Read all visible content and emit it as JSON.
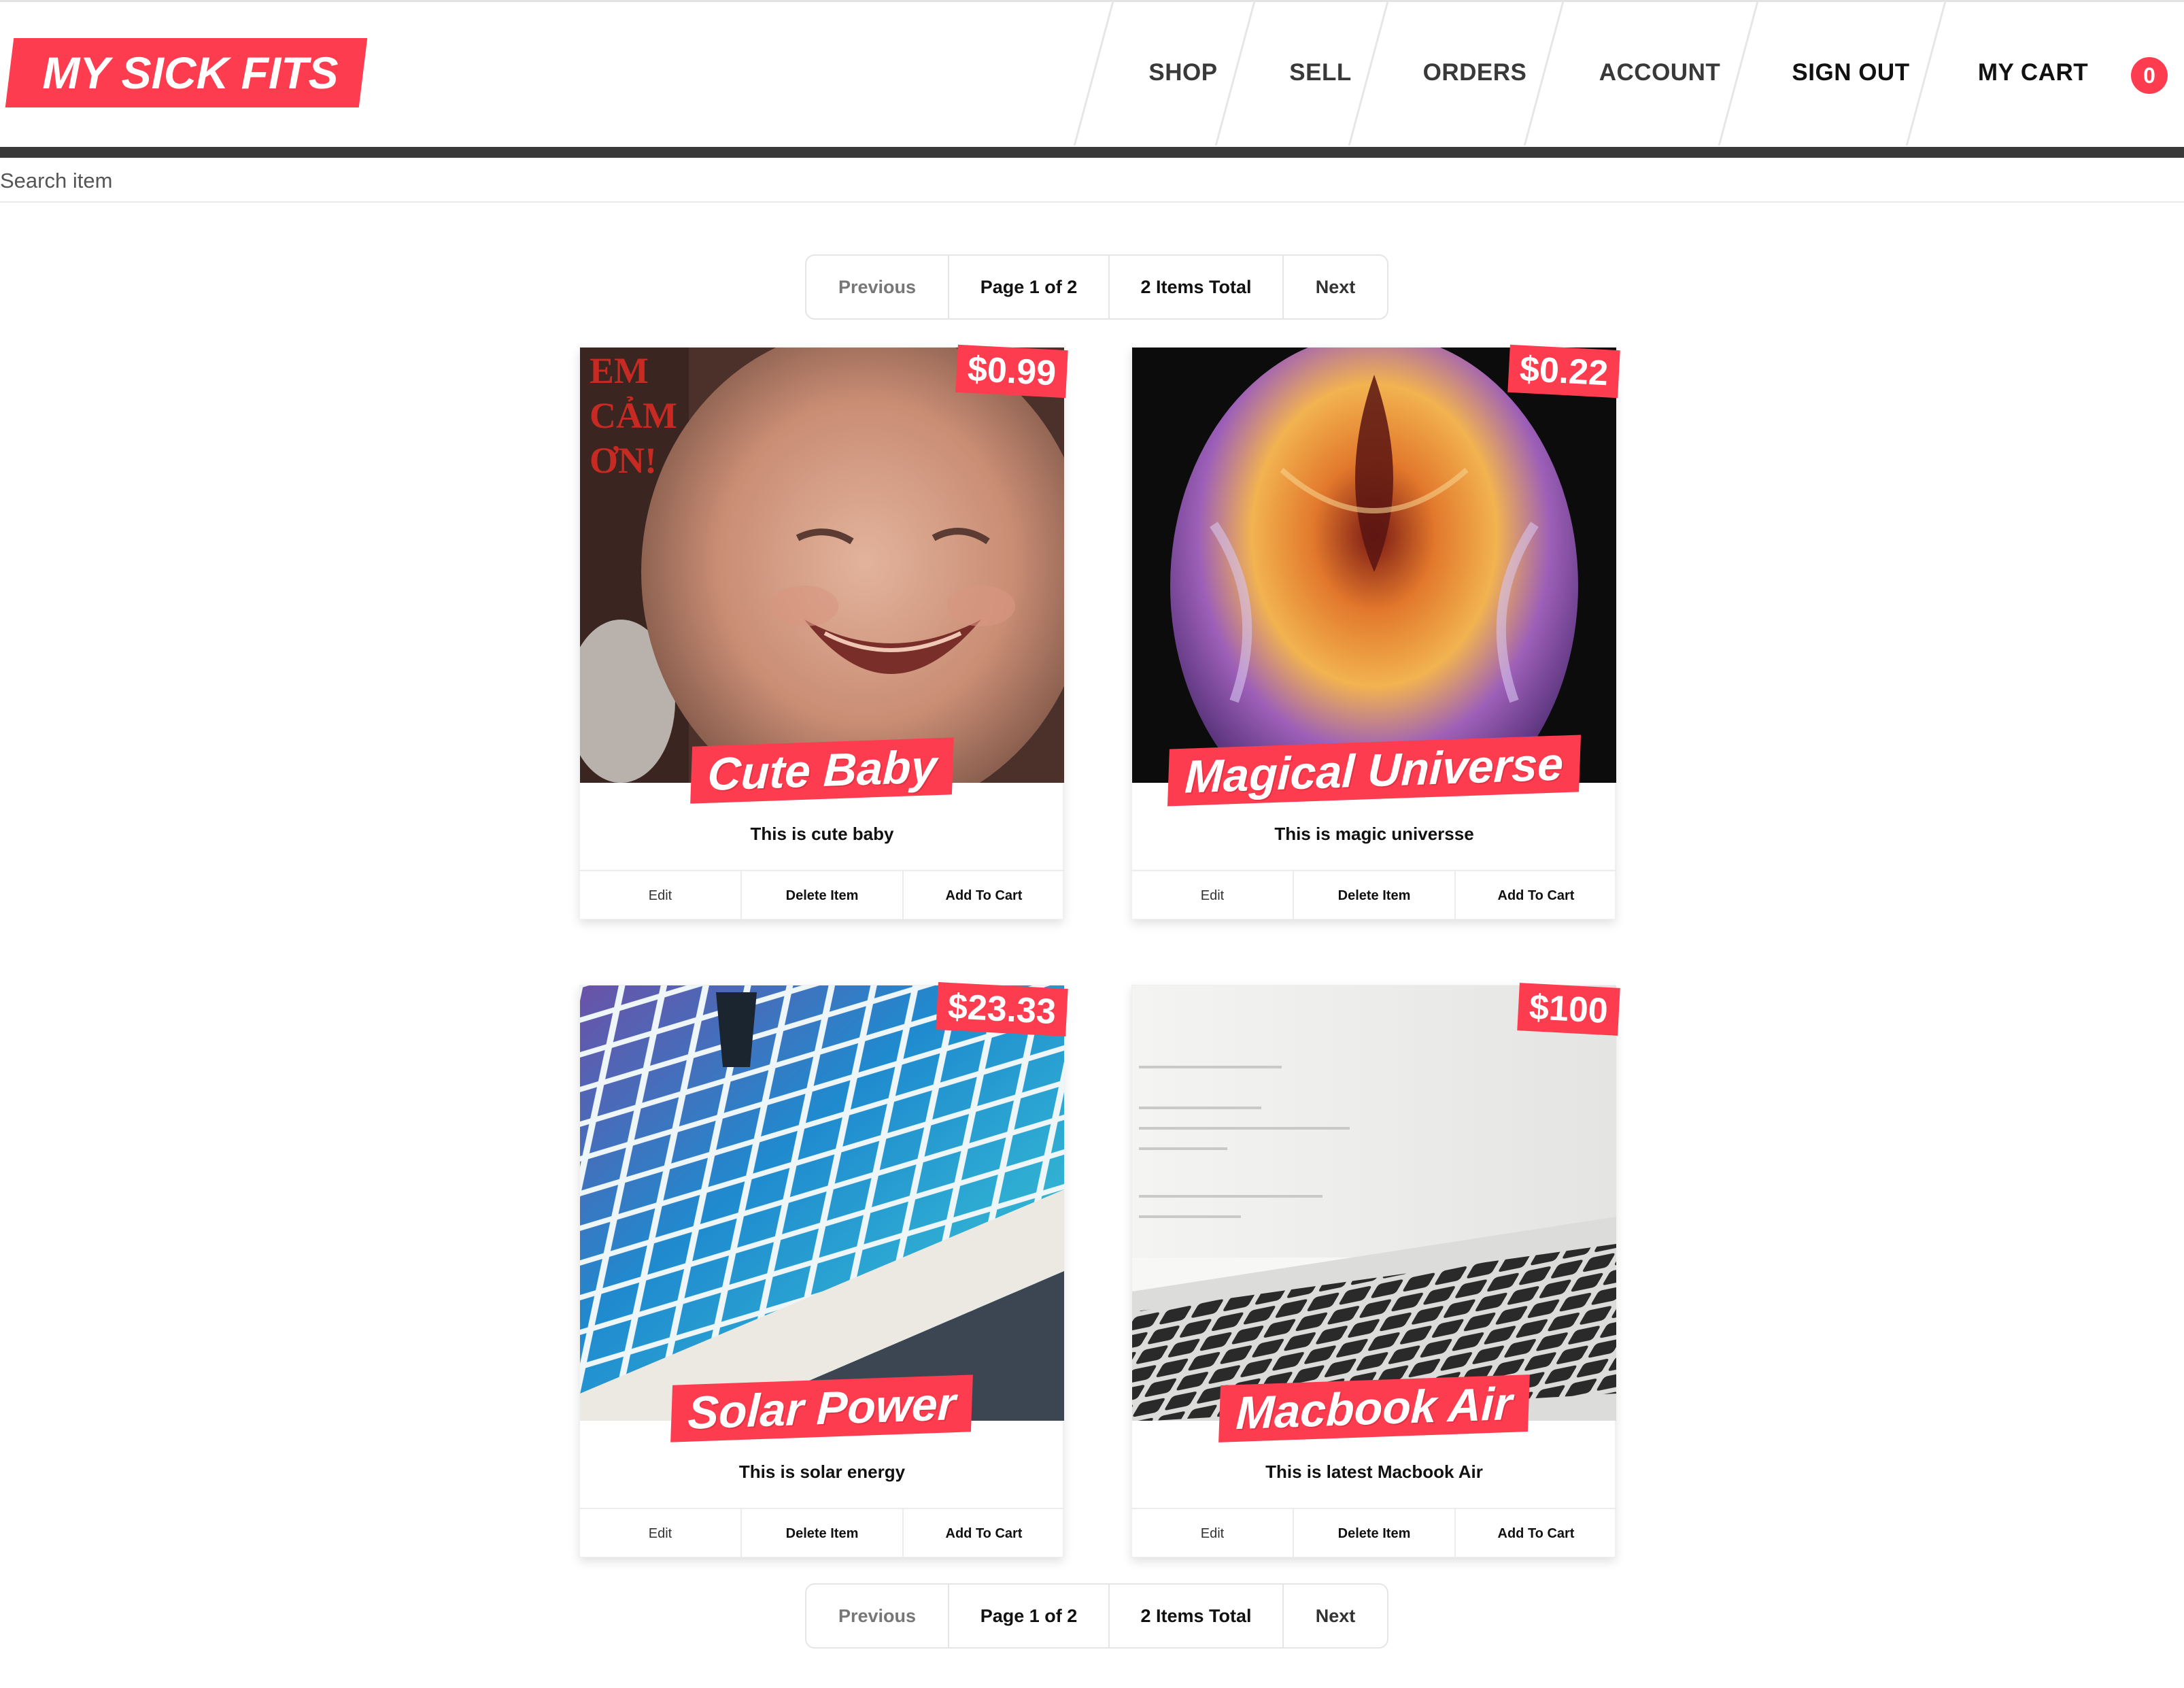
{
  "header": {
    "logo": "MY SICK FITS",
    "nav": [
      {
        "label": "SHOP"
      },
      {
        "label": "SELL"
      },
      {
        "label": "ORDERS"
      },
      {
        "label": "ACCOUNT"
      },
      {
        "label": "SIGN OUT"
      },
      {
        "label": "MY CART"
      }
    ],
    "cart_count": "0"
  },
  "search": {
    "placeholder": "Search item"
  },
  "pagination": {
    "previous": "Previous",
    "page": "Page 1 of 2",
    "total": "2 Items Total",
    "next": "Next"
  },
  "items": [
    {
      "title": "Cute Baby",
      "price": "$0.99",
      "description": "This is cute baby",
      "image_text": [
        "EM",
        "CẢM",
        "ƠN!"
      ]
    },
    {
      "title": "Magical Universe",
      "price": "$0.22",
      "description": "This is magic universse"
    },
    {
      "title": "Solar Power",
      "price": "$23.33",
      "description": "This is solar energy"
    },
    {
      "title": "Macbook Air",
      "price": "$100",
      "description": "This is latest Macbook Air"
    }
  ],
  "item_buttons": {
    "edit": "Edit",
    "delete": "Delete Item",
    "add": "Add To Cart"
  },
  "colors": {
    "accent": "#fe3c4f",
    "header_bar": "#393939"
  }
}
